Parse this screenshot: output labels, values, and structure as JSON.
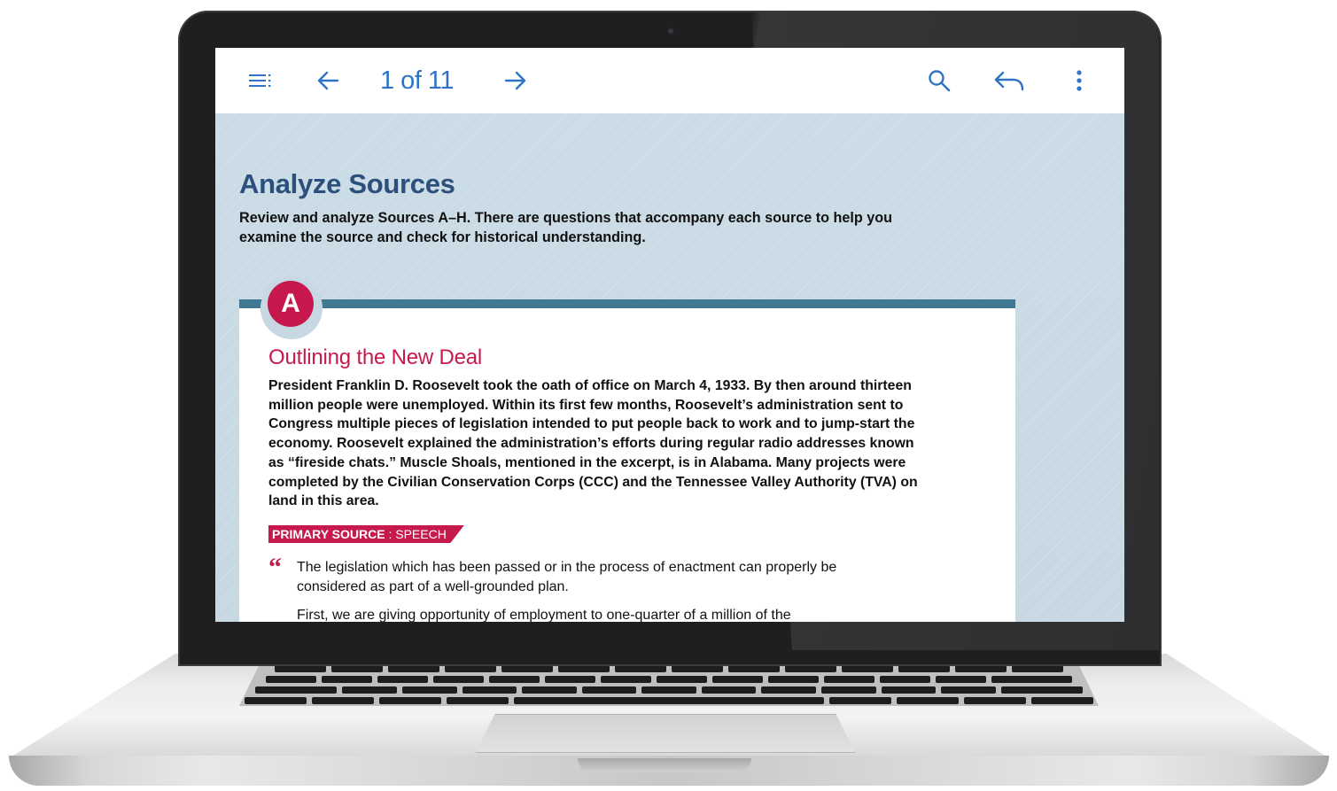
{
  "toolbar": {
    "page_indicator": "1 of 11",
    "accent_color": "#2f74c4"
  },
  "icons": [
    "menu-icon",
    "arrow-left-icon",
    "arrow-right-icon",
    "search-icon",
    "reply-icon",
    "more-vert-icon"
  ],
  "section": {
    "title": "Analyze Sources",
    "intro": "Review and analyze Sources A–H. There are questions that accompany each source to help you examine the source and check for historical understanding."
  },
  "source_a": {
    "badge": "A",
    "title": "Outlining the New Deal",
    "body": "President Franklin D. Roosevelt took the oath of office on March 4, 1933. By then around thirteen million people were unemployed. Within its first few months, Roosevelt’s administration sent to Congress multiple pieces of legislation intended to put people back to work and to jump-start the economy. Roosevelt explained the administration’s efforts during regular radio addresses known as “fireside chats.” Muscle Shoals, mentioned in the excerpt, is in Alabama. Many projects were completed by the Civilian Conservation Corps (CCC) and the Tennessee Valley Authority (TVA) on land in this area.",
    "tag_type": "PRIMARY SOURCE",
    "tag_separator": " : ",
    "tag_kind": "SPEECH",
    "quote_mark": "“",
    "quote_p1": "The legislation which has been passed or in the process of enactment can properly be considered as part of a well-grounded plan.",
    "quote_p2": "First, we are giving opportunity of employment to one-quarter of a million of the",
    "accent_color": "#c61a4d"
  }
}
